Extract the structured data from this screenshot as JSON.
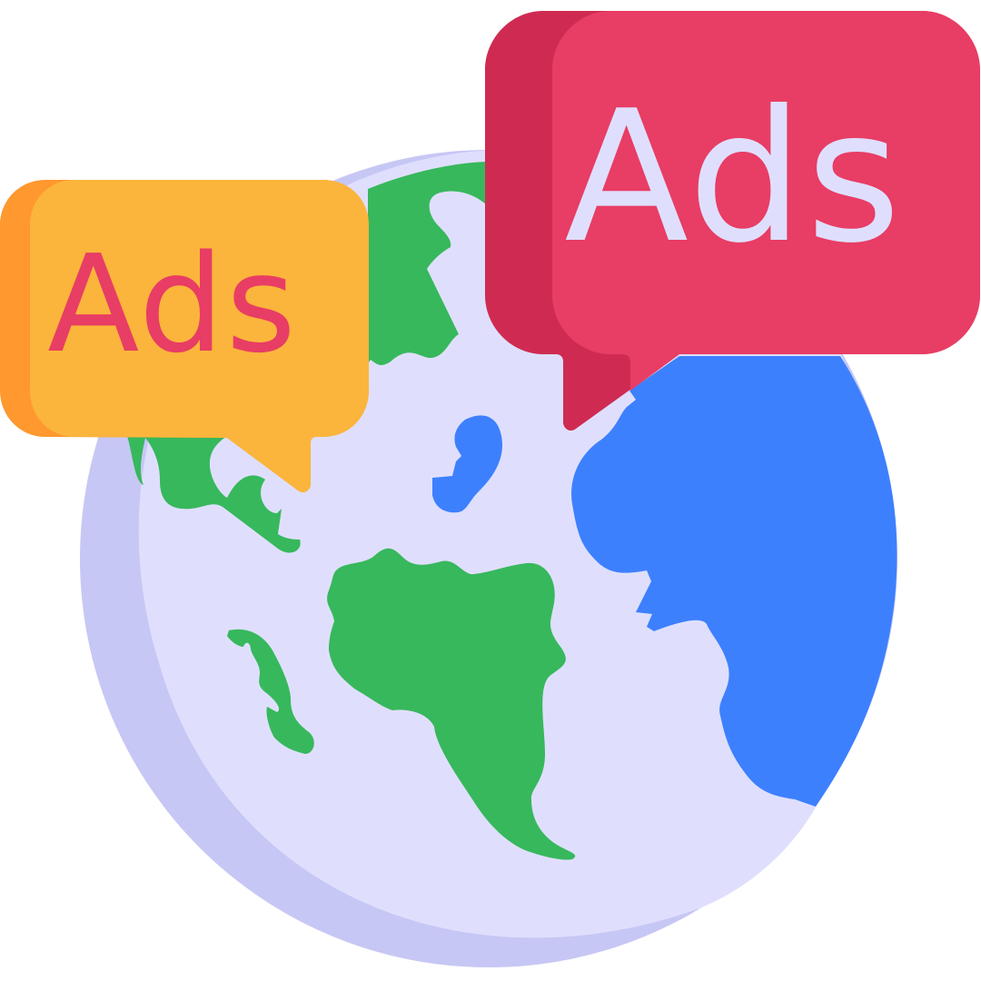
{
  "left_bubble": {
    "label": "Ads"
  },
  "right_bubble": {
    "label": "Ads"
  },
  "colors": {
    "globe_light": "#dfdffd",
    "globe_shadow": "#c7c7f5",
    "land_green": "#37b85c",
    "ocean_blue": "#3d80fe",
    "bubble_yellow": "#fbb53c",
    "bubble_yellow_shade": "#fe982f",
    "bubble_red": "#e83d64",
    "bubble_red_shade": "#cf2b52",
    "ads_text_on_yellow": "#e83d64",
    "ads_text_on_red": "#dfdffd"
  }
}
